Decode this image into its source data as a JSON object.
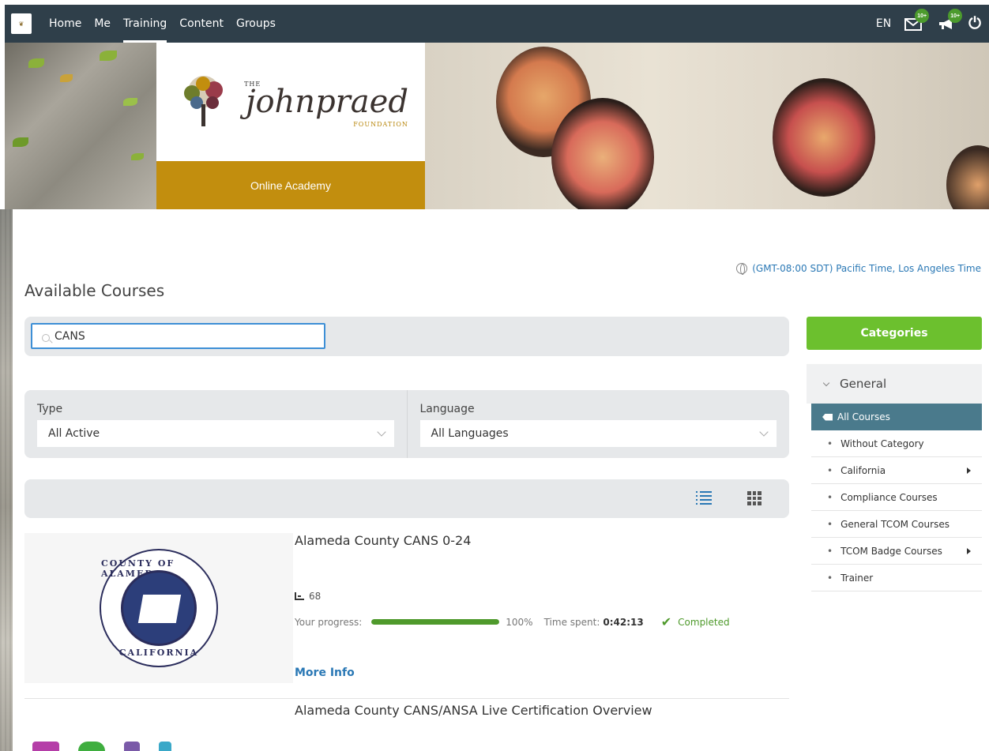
{
  "nav": {
    "items": [
      "Home",
      "Me",
      "Training",
      "Content",
      "Groups"
    ],
    "active_index": 2,
    "language": "EN",
    "messages_badge": "10+",
    "notifications_badge": "10+"
  },
  "banner": {
    "org_the": "THE",
    "org_name": "johnpraed",
    "org_foundation": "FOUNDATION",
    "academy_label": "Online Academy"
  },
  "timezone": "(GMT-08:00 SDT) Pacific Time, Los Angeles Time",
  "page_title": "Available Courses",
  "search": {
    "value": "CANS",
    "placeholder": ""
  },
  "filters": {
    "type_label": "Type",
    "type_value": "All Active",
    "language_label": "Language",
    "language_value": "All Languages"
  },
  "courses": [
    {
      "title": "Alameda County CANS 0-24",
      "lessons": "68",
      "progress_label": "Your progress:",
      "progress_percent": 100,
      "progress_text": "100%",
      "time_label": "Time spent:",
      "time_value": "0:42:13",
      "status": "Completed",
      "more": "More Info",
      "seal_top": "COUNTY OF ALAMEDA",
      "seal_bottom": "CALIFORNIA"
    },
    {
      "title": "Alameda County CANS/ANSA Live Certification Overview"
    }
  ],
  "sidebar": {
    "button": "Categories",
    "group": "General",
    "items": [
      {
        "label": "All Courses",
        "active": true
      },
      {
        "label": "Without Category"
      },
      {
        "label": "California",
        "has_children": true
      },
      {
        "label": "Compliance Courses"
      },
      {
        "label": "General TCOM Courses"
      },
      {
        "label": "TCOM Badge Courses",
        "has_children": true
      },
      {
        "label": "Trainer"
      }
    ]
  },
  "colors": {
    "topbar": "#2f3f4a",
    "accent_gold": "#c28e0e",
    "link_blue": "#2a78b5",
    "success_green": "#4f9a2c",
    "categories_green": "#6cc02e",
    "active_category": "#4a7a8c"
  }
}
